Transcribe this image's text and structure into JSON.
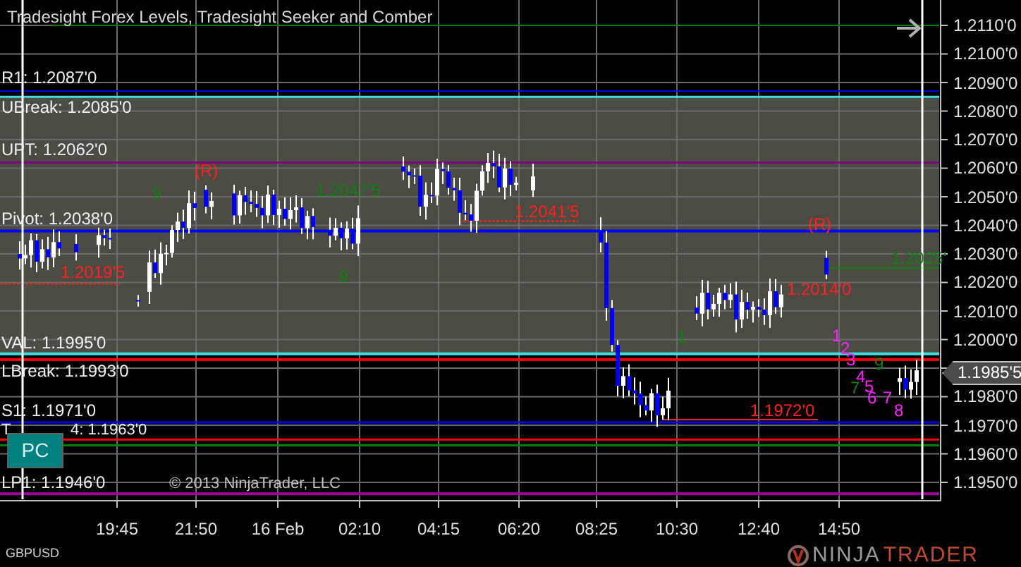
{
  "title": "Tradesight Forex Levels, Tradesight Seeker and Comber",
  "levels": [
    {
      "label": "R1: 1.2087'0",
      "color": "#0000ff"
    },
    {
      "label": "UBreak: 1.2085'0",
      "color": "#40e0e0"
    },
    {
      "label": "UPT: 1.2062'0",
      "color": "#800080"
    },
    {
      "label": "Pivot: 1.2038'0",
      "color": "#0000ff"
    },
    {
      "label": "VAL: 1.1995'0",
      "color": "#40e0e0"
    },
    {
      "label": "LBreak: 1.1993'0",
      "color": "#ff0000"
    },
    {
      "label": "S1: 1.1971'0",
      "color": "#0000ff"
    },
    {
      "label": "T",
      "color": "#ff0000"
    },
    {
      "label": "4: 1.1963'0",
      "color": "#008000"
    },
    {
      "label": "LP1: 1.1946'0",
      "color": "#a000a0"
    }
  ],
  "markers": [
    {
      "text": "(R)",
      "color": "#ff2020"
    },
    {
      "text": "1.2019'5",
      "color": "#ff2020"
    },
    {
      "text": "1.2047'5",
      "color": "#108010"
    },
    {
      "text": "1.2041'5",
      "color": "#ff2020"
    },
    {
      "text": "(R)",
      "color": "#ff2020"
    },
    {
      "text": "1.2025'",
      "color": "#108010"
    },
    {
      "text": "1.2014'0",
      "color": "#ff2020"
    },
    {
      "text": "1.1972'0",
      "color": "#ff2020"
    },
    {
      "text": "9",
      "color": "#108010"
    },
    {
      "text": "9",
      "color": "#108010"
    },
    {
      "text": "1",
      "color": "#108010"
    },
    {
      "text": "9",
      "color": "#108010"
    },
    {
      "text": "7",
      "color": "#108010"
    },
    {
      "text": "1",
      "color": "#ff20ff"
    },
    {
      "text": "2",
      "color": "#ff20ff"
    },
    {
      "text": "3",
      "color": "#ff20ff"
    },
    {
      "text": "4",
      "color": "#ff20ff"
    },
    {
      "text": "5",
      "color": "#ff20ff"
    },
    {
      "text": "6",
      "color": "#ff20ff"
    },
    {
      "text": "7",
      "color": "#ff20ff"
    },
    {
      "text": "8",
      "color": "#ff20ff"
    }
  ],
  "price_axis": {
    "ticks": [
      "1.2110'0",
      "1.2100'0",
      "1.2090'0",
      "1.2080'0",
      "1.2070'0",
      "1.2060'0",
      "1.2050'0",
      "1.2040'0",
      "1.2030'0",
      "1.2020'0",
      "1.2010'0",
      "1.2000'0",
      "1.1980'0",
      "1.1970'0",
      "1.1960'0",
      "1.1950'0"
    ],
    "current_price": "1.1985'5"
  },
  "time_axis": [
    "19:45",
    "21:50",
    "16 Feb",
    "02:10",
    "04:15",
    "06:20",
    "08:25",
    "10:30",
    "12:40",
    "14:50"
  ],
  "pc_button": "PC",
  "copyright": "© 2013 NinjaTrader, LLC",
  "symbol": "GBPUSD",
  "brand": {
    "part_1": "NINJA",
    "part_2": "TRADER"
  }
}
